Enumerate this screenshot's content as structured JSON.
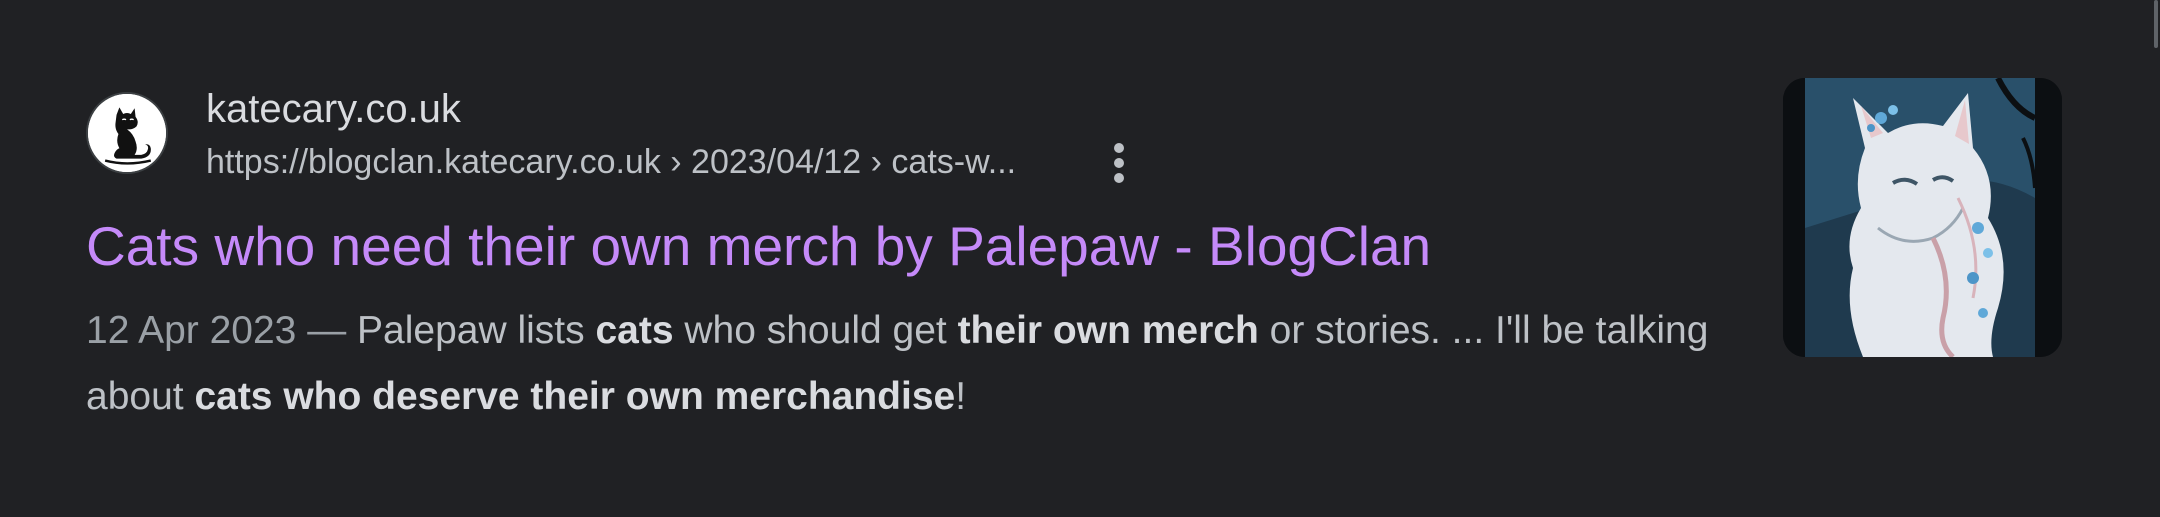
{
  "result": {
    "site_name": "katecary.co.uk",
    "breadcrumb": "https://blogclan.katecary.co.uk › 2023/04/12 › cats-w...",
    "title": "Cats who need their own merch by Palepaw - BlogClan",
    "snippet": {
      "date": "12 Apr 2023",
      "separator": " — ",
      "seg1": "Palepaw lists ",
      "bold1": "cats",
      "seg2": " who should get ",
      "bold2": "their own merch",
      "seg3": " or stories. ... I'll be talking about ",
      "bold3": "cats who deserve their own merchandise",
      "seg4": "!"
    },
    "favicon_icon": "cat-silhouette-icon",
    "more_icon": "three-dots-vertical-icon",
    "thumbnail_subject": "white-cat-illustration"
  },
  "colors": {
    "background": "#202124",
    "title_link": "#c58af9",
    "site_name": "#dadce0",
    "url_text": "#bdc1c6",
    "snippet_text": "#bdc1c6",
    "date_text": "#9aa0a6"
  }
}
